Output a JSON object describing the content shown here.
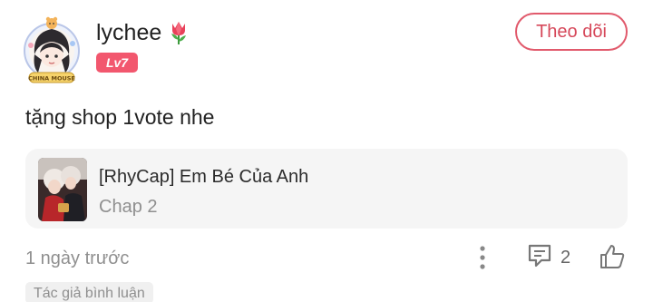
{
  "user": {
    "name": "lychee",
    "level": "Lv7",
    "avatar_frame_text": "CHINA MOUSE"
  },
  "follow_button": {
    "label": "Theo dõi"
  },
  "comment": {
    "text": "tặng shop 1vote nhe"
  },
  "story_card": {
    "title": "[RhyCap] Em Bé Của Anh",
    "chapter": "Chap 2"
  },
  "footer": {
    "timestamp": "1 ngày trước",
    "reply_count": "2"
  },
  "tag": {
    "label": "Tác giả bình luận"
  },
  "colors": {
    "accent": "#e15a6c",
    "level_badge": "#f2576e",
    "muted_text": "#8f8f8f",
    "card_bg": "#f5f5f5"
  },
  "icons": {
    "avatar_decoration": "avatar-frame",
    "username_emoji": "tulip-icon",
    "more": "more-vertical-icon",
    "reply": "comment-icon",
    "like": "thumbs-up-icon"
  }
}
